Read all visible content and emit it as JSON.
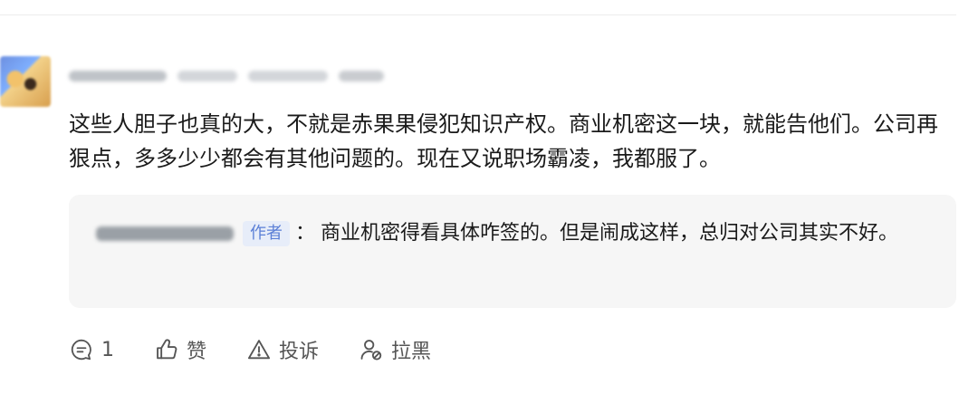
{
  "comment": {
    "text": "这些人胆子也真的大，不就是赤果果侵犯知识产权。商业机密这一块，就能告他们。公司再狠点，多多少少都会有其他问题的。现在又说职场霸凌，我都服了。"
  },
  "reply": {
    "author_tag": "作者",
    "separator": "：",
    "text": "商业机密得看具体咋签的。但是闹成这样，总归对公司其实不好。"
  },
  "actions": {
    "reply_count": "1",
    "like_label": "赞",
    "report_label": "投诉",
    "block_label": "拉黑"
  },
  "icons": {
    "reply": "comment-bubble-icon",
    "like": "thumbs-up-icon",
    "report": "warning-icon",
    "block": "user-block-icon"
  }
}
